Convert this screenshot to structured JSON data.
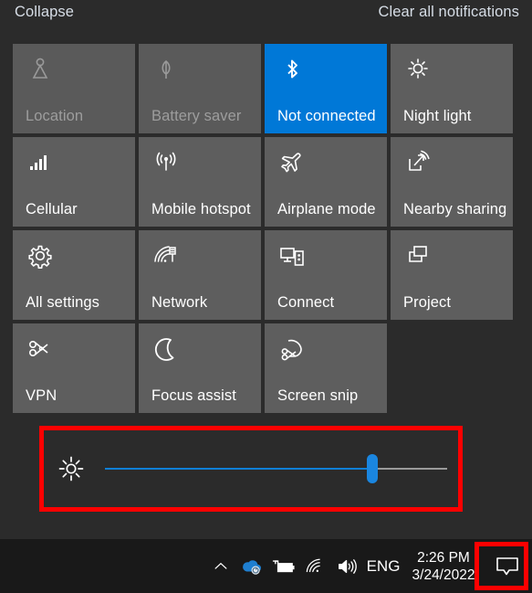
{
  "header": {
    "collapse_label": "Collapse",
    "clear_label": "Clear all notifications"
  },
  "colors": {
    "accent": "#0078d7",
    "panel_bg": "#2b2b2b",
    "tile_bg": "#5e5e5e",
    "tile_disabled_text": "#9d9d9d",
    "taskbar_bg": "#191919",
    "annotation_red": "#fe0000",
    "slider_fill": "#0f7fd6",
    "slider_thumb": "#1a86e0",
    "slider_track": "#9a9a9a"
  },
  "quick_actions": {
    "rows": [
      [
        {
          "label": "Location",
          "icon": "location-icon",
          "state": "disabled"
        },
        {
          "label": "Battery saver",
          "icon": "battery-saver-icon",
          "state": "disabled"
        },
        {
          "label": "Not connected",
          "icon": "bluetooth-icon",
          "state": "active"
        },
        {
          "label": "Night light",
          "icon": "night-light-icon",
          "state": "normal"
        }
      ],
      [
        {
          "label": "Cellular",
          "icon": "cellular-icon",
          "state": "normal"
        },
        {
          "label": "Mobile hotspot",
          "icon": "mobile-hotspot-icon",
          "state": "normal"
        },
        {
          "label": "Airplane mode",
          "icon": "airplane-icon",
          "state": "normal"
        },
        {
          "label": "Nearby sharing",
          "icon": "nearby-sharing-icon",
          "state": "normal"
        }
      ],
      [
        {
          "label": "All settings",
          "icon": "gear-icon",
          "state": "normal"
        },
        {
          "label": "Network",
          "icon": "network-icon",
          "state": "normal"
        },
        {
          "label": "Connect",
          "icon": "connect-icon",
          "state": "normal"
        },
        {
          "label": "Project",
          "icon": "project-icon",
          "state": "normal"
        }
      ],
      [
        {
          "label": "VPN",
          "icon": "vpn-icon",
          "state": "normal"
        },
        {
          "label": "Focus assist",
          "icon": "moon-icon",
          "state": "normal"
        },
        {
          "label": "Screen snip",
          "icon": "screen-snip-icon",
          "state": "normal"
        }
      ]
    ]
  },
  "brightness": {
    "icon": "brightness-icon",
    "value_percent": 78
  },
  "annotations": [
    {
      "name": "brightness-slider-highlight",
      "color": "#fe0000"
    },
    {
      "name": "action-center-button-highlight",
      "color": "#fe0000"
    }
  ],
  "taskbar": {
    "tray": {
      "chevron": "show-hidden-icons-icon",
      "onedrive": "onedrive-icon",
      "battery": "battery-charging-icon",
      "wifi": "wifi-icon",
      "volume": "volume-icon",
      "language": "ENG",
      "time": "2:26 PM",
      "date": "3/24/2022",
      "action_center": "action-center-icon"
    }
  }
}
